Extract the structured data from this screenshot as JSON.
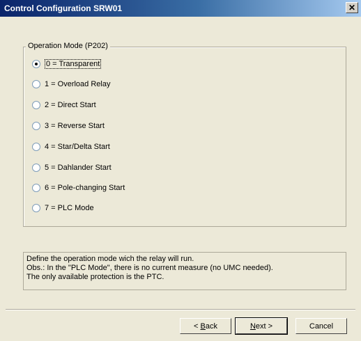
{
  "window": {
    "title": "Control Configuration SRW01",
    "close_glyph": "✕"
  },
  "group": {
    "legend": "Operation Mode (P202)",
    "options": [
      {
        "label": "0 = Transparent",
        "checked": true
      },
      {
        "label": "1 = Overload Relay",
        "checked": false
      },
      {
        "label": "2 = Direct Start",
        "checked": false
      },
      {
        "label": "3 = Reverse Start",
        "checked": false
      },
      {
        "label": "4 = Star/Delta Start",
        "checked": false
      },
      {
        "label": "5 = Dahlander Start",
        "checked": false
      },
      {
        "label": "6 = Pole-changing Start",
        "checked": false
      },
      {
        "label": "7 = PLC Mode",
        "checked": false
      }
    ]
  },
  "info": {
    "lines": [
      "Define the operation mode wich the relay will run.",
      "Obs.: In the \"PLC Mode\", there is no current measure (no UMC needed).",
      "The only available protection is the PTC."
    ]
  },
  "buttons": {
    "back": {
      "prefix": "< ",
      "mnemonic": "B",
      "rest": "ack"
    },
    "next": {
      "mnemonic": "N",
      "rest": "ext >"
    },
    "cancel": "Cancel"
  },
  "icons": {
    "close": "close-icon",
    "radio_selected": "radio-selected",
    "radio_unselected": "radio-unselected"
  }
}
